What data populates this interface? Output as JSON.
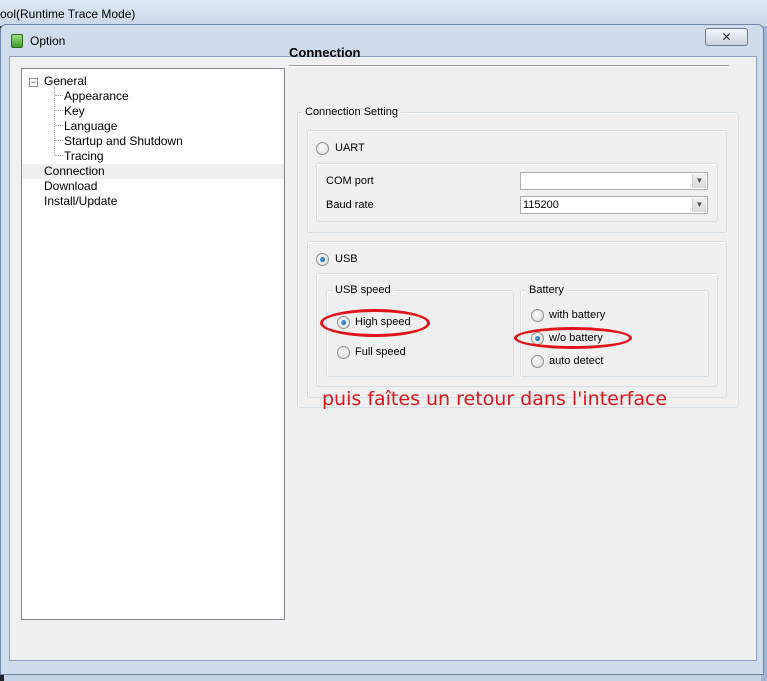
{
  "background_app": {
    "title": "ool(Runtime Trace Mode)"
  },
  "dialog": {
    "title": "Option",
    "close_glyph": "✕"
  },
  "tree": {
    "items": [
      {
        "label": "General",
        "level": 0,
        "expander": "−"
      },
      {
        "label": "Appearance",
        "level": 1
      },
      {
        "label": "Key",
        "level": 1
      },
      {
        "label": "Language",
        "level": 1
      },
      {
        "label": "Startup and Shutdown",
        "level": 1
      },
      {
        "label": "Tracing",
        "level": 1
      },
      {
        "label": "Connection",
        "level": 0,
        "selected": true
      },
      {
        "label": "Download",
        "level": 0
      },
      {
        "label": "Install/Update",
        "level": 0
      }
    ]
  },
  "panel": {
    "title": "Connection",
    "group_label": "Connection Setting",
    "uart": {
      "label": "UART",
      "checked": false,
      "com_port_label": "COM port",
      "com_port_value": "",
      "baud_rate_label": "Baud rate",
      "baud_rate_value": "115200"
    },
    "usb": {
      "label": "USB",
      "checked": true,
      "speed_group": "USB speed",
      "speed_options": [
        {
          "label": "High speed",
          "checked": true
        },
        {
          "label": "Full speed",
          "checked": false
        }
      ],
      "battery_group": "Battery",
      "battery_options": [
        {
          "label": "with battery",
          "checked": false
        },
        {
          "label": "w/o battery",
          "checked": true
        },
        {
          "label": "auto detect",
          "checked": false
        }
      ]
    }
  },
  "annotation": {
    "text": "puis faîtes un retour dans l'interface",
    "color": "#e1141b"
  }
}
